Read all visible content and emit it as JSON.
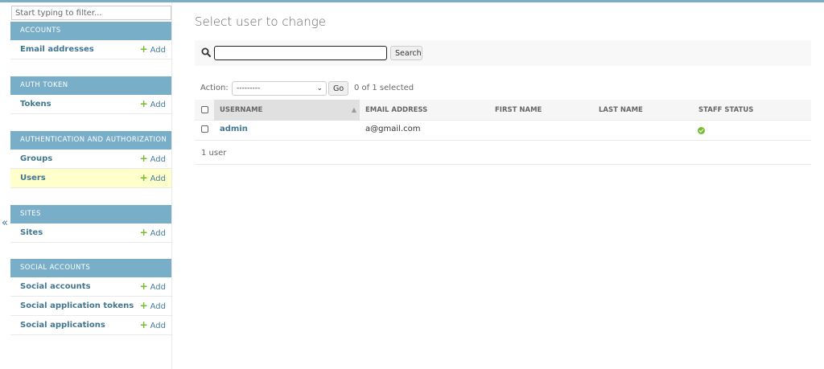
{
  "sidebar": {
    "filter_placeholder": "Start typing to filter...",
    "collapse_glyph": "«",
    "add_label": "Add",
    "modules": [
      {
        "caption": "ACCOUNTS",
        "models": [
          {
            "name": "Email addresses",
            "current": false
          }
        ]
      },
      {
        "caption": "AUTH TOKEN",
        "models": [
          {
            "name": "Tokens",
            "current": false
          }
        ]
      },
      {
        "caption": "AUTHENTICATION AND AUTHORIZATION",
        "models": [
          {
            "name": "Groups",
            "current": false
          },
          {
            "name": "Users",
            "current": true
          }
        ]
      },
      {
        "caption": "SITES",
        "models": [
          {
            "name": "Sites",
            "current": false
          }
        ]
      },
      {
        "caption": "SOCIAL ACCOUNTS",
        "models": [
          {
            "name": "Social accounts",
            "current": false
          },
          {
            "name": "Social application tokens",
            "current": false
          },
          {
            "name": "Social applications",
            "current": false
          }
        ]
      }
    ]
  },
  "main": {
    "title": "Select user to change",
    "search": {
      "value": "",
      "button_label": "Search",
      "icon": "search-icon"
    },
    "actions": {
      "label": "Action:",
      "selected_value": "---------",
      "go_label": "Go",
      "selected_count": "0 of 1 selected"
    },
    "table": {
      "columns": [
        "USERNAME",
        "EMAIL ADDRESS",
        "FIRST NAME",
        "LAST NAME",
        "STAFF STATUS"
      ],
      "rows": [
        {
          "username": "admin",
          "email": "a@gmail.com",
          "first_name": "",
          "last_name": "",
          "staff_status": true
        }
      ]
    },
    "paginator": "1 user"
  },
  "colors": {
    "module_caption_bg": "#79aec8",
    "link": "#417690",
    "add_plus": "#70bf2b",
    "current_row_bg": "#ffffcc",
    "yes_icon": "#70bf2b"
  }
}
